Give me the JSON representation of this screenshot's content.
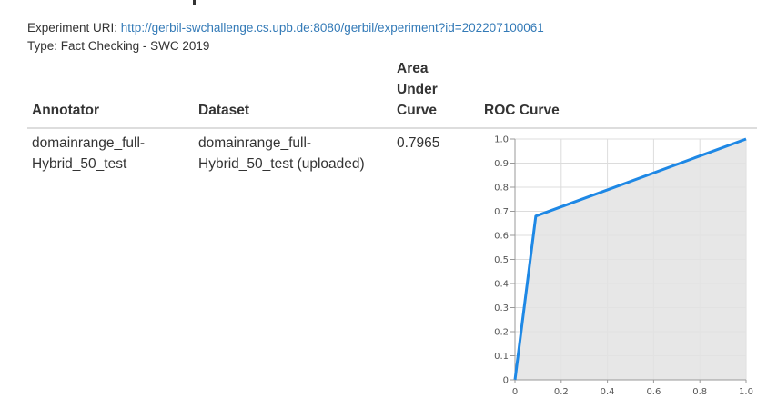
{
  "experiment": {
    "uri_label": "Experiment URI:",
    "uri": "http://gerbil-swchallenge.cs.upb.de:8080/gerbil/experiment?id=202207100061",
    "type_label": "Type:",
    "type": "Fact Checking - SWC 2019"
  },
  "table": {
    "headers": {
      "annotator": "Annotator",
      "dataset": "Dataset",
      "auc": [
        "Area",
        "Under",
        "Curve"
      ],
      "roc": "ROC Curve"
    },
    "rows": [
      {
        "annotator": [
          "domainrange_full-",
          "Hybrid_50_test"
        ],
        "dataset": [
          "domainrange_full-",
          "Hybrid_50_test (uploaded)"
        ],
        "auc": "0.7965"
      }
    ]
  },
  "chart_data": {
    "type": "area",
    "x": [
      0,
      0.09,
      1.0
    ],
    "y": [
      0,
      0.68,
      1.0
    ],
    "xlim": [
      0,
      1.0
    ],
    "ylim": [
      0,
      1.0
    ],
    "x_ticks": [
      "0",
      "0.2",
      "0.4",
      "0.6",
      "0.8",
      "1.0"
    ],
    "y_ticks": [
      "0",
      "0.1",
      "0.2",
      "0.3",
      "0.4",
      "0.5",
      "0.6",
      "0.7",
      "0.8",
      "0.9",
      "1.0"
    ],
    "grid": true,
    "line_color": "#1e88e5",
    "fill_color": "#e3e3e3"
  }
}
